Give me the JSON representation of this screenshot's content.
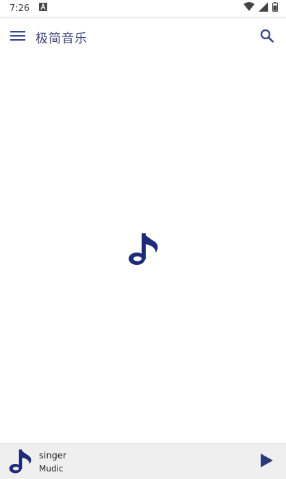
{
  "status_bar": {
    "time": "7:26"
  },
  "app_bar": {
    "title": "极简音乐"
  },
  "mini_player": {
    "title": "singer",
    "subtitle": "Mudic"
  },
  "colors": {
    "accent": "#1f2a7a",
    "title": "#3b3f7a",
    "player_bg": "#efefef"
  },
  "icons": [
    "notification-a-icon",
    "wifi-icon",
    "signal-icon",
    "battery-icon",
    "menu-icon",
    "search-icon",
    "music-note-icon",
    "play-icon"
  ]
}
